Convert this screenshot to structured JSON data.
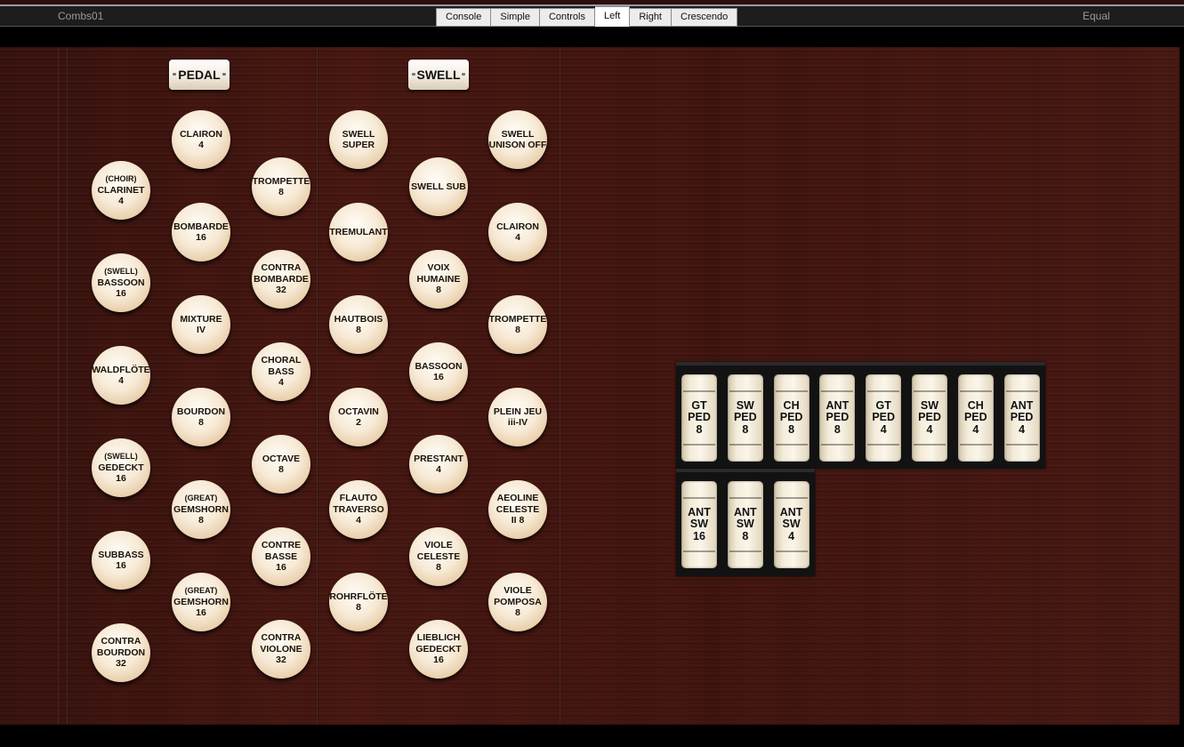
{
  "titlebar": {
    "combination": "Combs01",
    "temperament": "Equal"
  },
  "tabs": [
    {
      "label": "Console",
      "active": false
    },
    {
      "label": "Simple",
      "active": false
    },
    {
      "label": "Controls",
      "active": false
    },
    {
      "label": "Left",
      "active": true
    },
    {
      "label": "Right",
      "active": false
    },
    {
      "label": "Crescendo",
      "active": false
    }
  ],
  "divisions": {
    "pedal": "PEDAL",
    "swell": "SWELL"
  },
  "stops": {
    "pedal_col1": [
      {
        "sub": "(CHOIR)",
        "name": "CLARINET",
        "pitch": "4"
      },
      {
        "sub": "(SWELL)",
        "name": "BASSOON",
        "pitch": "16"
      },
      {
        "sub": "",
        "name": "WALDFLÖTE",
        "pitch": "4"
      },
      {
        "sub": "(SWELL)",
        "name": "GEDECKT",
        "pitch": "16"
      },
      {
        "sub": "",
        "name": "SUBBASS",
        "pitch": "16"
      },
      {
        "sub": "",
        "name": "CONTRA BOURDON",
        "pitch": "32"
      }
    ],
    "pedal_col2": [
      {
        "sub": "",
        "name": "CLAIRON",
        "pitch": "4"
      },
      {
        "sub": "",
        "name": "BOMBARDE",
        "pitch": "16"
      },
      {
        "sub": "",
        "name": "MIXTURE",
        "pitch": "IV"
      },
      {
        "sub": "",
        "name": "BOURDON",
        "pitch": "8"
      },
      {
        "sub": "(GREAT)",
        "name": "GEMSHORN",
        "pitch": "8"
      },
      {
        "sub": "(GREAT)",
        "name": "GEMSHORN",
        "pitch": "16"
      }
    ],
    "pedal_col3": [
      {
        "sub": "",
        "name": "TROMPETTE",
        "pitch": "8"
      },
      {
        "sub": "",
        "name": "CONTRA BOMBARDE",
        "pitch": "32"
      },
      {
        "sub": "",
        "name": "CHORAL BASS",
        "pitch": "4"
      },
      {
        "sub": "",
        "name": "OCTAVE",
        "pitch": "8"
      },
      {
        "sub": "",
        "name": "CONTRE BASSE",
        "pitch": "16"
      },
      {
        "sub": "",
        "name": "CONTRA VIOLONE",
        "pitch": "32"
      }
    ],
    "swell_col1": [
      {
        "sub": "",
        "name": "SWELL SUPER",
        "pitch": ""
      },
      {
        "sub": "",
        "name": "TREMULANT",
        "pitch": ""
      },
      {
        "sub": "",
        "name": "HAUTBOIS",
        "pitch": "8"
      },
      {
        "sub": "",
        "name": "OCTAVIN",
        "pitch": "2"
      },
      {
        "sub": "",
        "name": "FLAUTO TRAVERSO",
        "pitch": "4"
      },
      {
        "sub": "",
        "name": "ROHRFLÖTE",
        "pitch": "8"
      }
    ],
    "swell_col2": [
      {
        "sub": "",
        "name": "SWELL SUB",
        "pitch": ""
      },
      {
        "sub": "",
        "name": "VOIX HUMAINE",
        "pitch": "8"
      },
      {
        "sub": "",
        "name": "BASSOON",
        "pitch": "16"
      },
      {
        "sub": "",
        "name": "PRESTANT",
        "pitch": "4"
      },
      {
        "sub": "",
        "name": "VIOLE CELESTE",
        "pitch": "8"
      },
      {
        "sub": "",
        "name": "LIEBLICH GEDECKT",
        "pitch": "16"
      }
    ],
    "swell_col3": [
      {
        "sub": "",
        "name": "SWELL UNISON OFF",
        "pitch": ""
      },
      {
        "sub": "",
        "name": "CLAIRON",
        "pitch": "4"
      },
      {
        "sub": "",
        "name": "TROMPETTE",
        "pitch": "8"
      },
      {
        "sub": "",
        "name": "PLEIN JEU",
        "pitch": "iii-IV"
      },
      {
        "sub": "",
        "name": "AEOLINE CELESTE",
        "pitch": "II 8"
      },
      {
        "sub": "",
        "name": "VIOLE POMPOSA",
        "pitch": "8"
      }
    ]
  },
  "couplers": {
    "row1": [
      {
        "l1": "GT",
        "l2": "PED",
        "l3": "8"
      },
      {
        "l1": "SW",
        "l2": "PED",
        "l3": "8"
      },
      {
        "l1": "CH",
        "l2": "PED",
        "l3": "8"
      },
      {
        "l1": "ANT",
        "l2": "PED",
        "l3": "8"
      },
      {
        "l1": "GT",
        "l2": "PED",
        "l3": "4"
      },
      {
        "l1": "SW",
        "l2": "PED",
        "l3": "4"
      },
      {
        "l1": "CH",
        "l2": "PED",
        "l3": "4"
      },
      {
        "l1": "ANT",
        "l2": "PED",
        "l3": "4"
      }
    ],
    "row2": [
      {
        "l1": "ANT",
        "l2": "SW",
        "l3": "16"
      },
      {
        "l1": "ANT",
        "l2": "SW",
        "l3": "8"
      },
      {
        "l1": "ANT",
        "l2": "SW",
        "l3": "4"
      }
    ]
  }
}
